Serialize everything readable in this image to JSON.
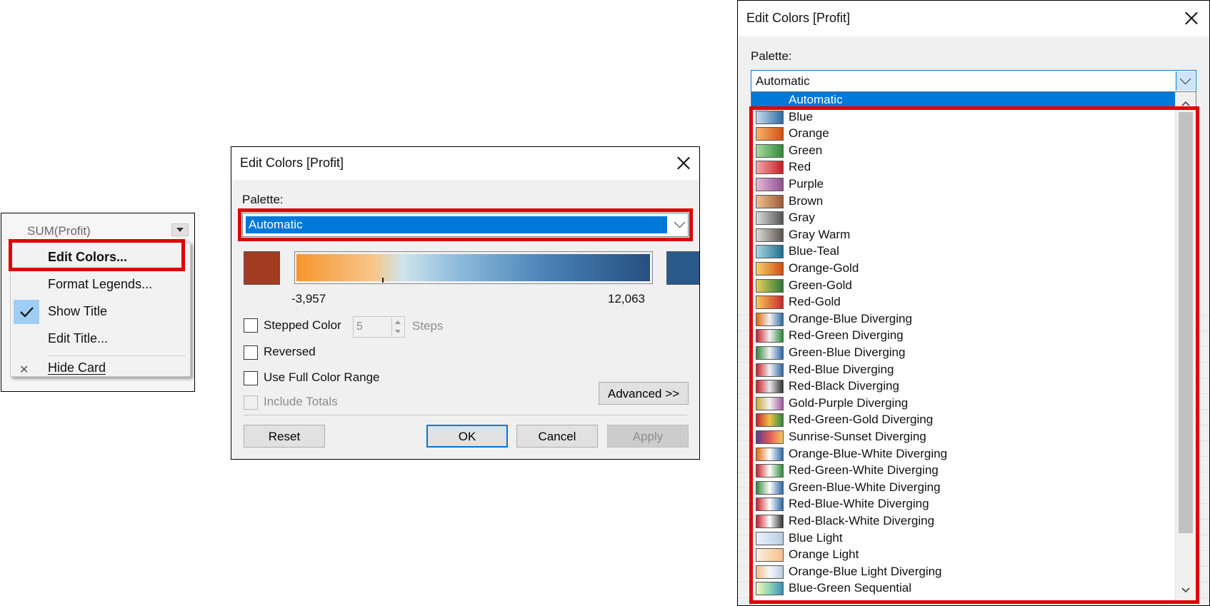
{
  "colors": {
    "selection_blue": "#0078d7",
    "highlight_red": "#e00000",
    "start_swatch": "#a23b22",
    "end_swatch": "#2a5a8c"
  },
  "menu": {
    "card_label": "SUM(Profit)",
    "items": [
      {
        "label": "Edit Colors...",
        "icon": ""
      },
      {
        "label": "Format Legends...",
        "icon": ""
      },
      {
        "label": "Show Title",
        "icon": "checkmark-icon"
      },
      {
        "label": "Edit Title...",
        "icon": ""
      },
      {
        "label": "Hide Card",
        "icon": "close-icon"
      }
    ]
  },
  "dialog": {
    "title": "Edit Colors [Profit]",
    "palette_label": "Palette:",
    "palette_value": "Automatic",
    "range_min": "-3,957",
    "range_max": "12,063",
    "stepped_color_label": "Stepped Color",
    "steps_value": "5",
    "steps_label": "Steps",
    "reversed_label": "Reversed",
    "full_range_label": "Use Full Color Range",
    "include_totals_label": "Include Totals",
    "advanced_label": "Advanced >>",
    "reset_label": "Reset",
    "ok_label": "OK",
    "cancel_label": "Cancel",
    "apply_label": "Apply"
  },
  "dropdown": {
    "title": "Edit Colors [Profit]",
    "palette_label": "Palette:",
    "palette_value": "Automatic",
    "selected_label": "Automatic",
    "items": [
      {
        "label": "Blue",
        "gradient": "linear-gradient(90deg,#c8dcee,#2f6aa3)"
      },
      {
        "label": "Orange",
        "gradient": "linear-gradient(90deg,#f9b26a,#d2500e)"
      },
      {
        "label": "Green",
        "gradient": "linear-gradient(90deg,#a8dc9c,#2f8a3a)"
      },
      {
        "label": "Red",
        "gradient": "linear-gradient(90deg,#f6a7a7,#c81e24)"
      },
      {
        "label": "Purple",
        "gradient": "linear-gradient(90deg,#e5b9d8,#8e5192)"
      },
      {
        "label": "Brown",
        "gradient": "linear-gradient(90deg,#f1c28f,#9a5a37)"
      },
      {
        "label": "Gray",
        "gradient": "linear-gradient(90deg,#dcdcdc,#555555)"
      },
      {
        "label": "Gray Warm",
        "gradient": "linear-gradient(90deg,#dedad5,#5b5550)"
      },
      {
        "label": "Blue-Teal",
        "gradient": "linear-gradient(90deg,#a8d8e3,#1e6d8f)"
      },
      {
        "label": "Orange-Gold",
        "gradient": "linear-gradient(90deg,#f6d06a,#d24c12)"
      },
      {
        "label": "Green-Gold",
        "gradient": "linear-gradient(90deg,#e8d15a,#2c7a3a)"
      },
      {
        "label": "Red-Gold",
        "gradient": "linear-gradient(90deg,#f6c85a,#cc2a2a)"
      },
      {
        "label": "Orange-Blue Diverging",
        "gradient": "linear-gradient(90deg,#e0690f,#f2f2f2,#2d6aa5)"
      },
      {
        "label": "Red-Green Diverging",
        "gradient": "linear-gradient(90deg,#c8222a,#f2f2f2,#2f8a3a)"
      },
      {
        "label": "Green-Blue Diverging",
        "gradient": "linear-gradient(90deg,#2f8a3a,#f2f2f2,#2d6aa5)"
      },
      {
        "label": "Red-Blue Diverging",
        "gradient": "linear-gradient(90deg,#c8222a,#f2f2f2,#2d6aa5)"
      },
      {
        "label": "Red-Black Diverging",
        "gradient": "linear-gradient(90deg,#c8222a,#e8e8e8,#333333)"
      },
      {
        "label": "Gold-Purple Diverging",
        "gradient": "linear-gradient(90deg,#c9a93a,#f2f2f2,#a05c9c)"
      },
      {
        "label": "Red-Green-Gold Diverging",
        "gradient": "linear-gradient(90deg,#c8222a,#f0c04a,#2f8a3a)"
      },
      {
        "label": "Sunrise-Sunset Diverging",
        "gradient": "linear-gradient(90deg,#5a3b8c,#e05a5a,#f6c85a)"
      },
      {
        "label": "Orange-Blue-White Diverging",
        "gradient": "linear-gradient(90deg,#e0690f,#ffffff,#2d6aa5)"
      },
      {
        "label": "Red-Green-White Diverging",
        "gradient": "linear-gradient(90deg,#c8222a,#ffffff,#2f8a3a)"
      },
      {
        "label": "Green-Blue-White Diverging",
        "gradient": "linear-gradient(90deg,#2f8a3a,#ffffff,#2d6aa5)"
      },
      {
        "label": "Red-Blue-White Diverging",
        "gradient": "linear-gradient(90deg,#c8222a,#ffffff,#2d6aa5)"
      },
      {
        "label": "Red-Black-White Diverging",
        "gradient": "linear-gradient(90deg,#c8222a,#ffffff,#333333)"
      },
      {
        "label": "Blue Light",
        "gradient": "linear-gradient(90deg,#eaf1f9,#b9cde6)"
      },
      {
        "label": "Orange Light",
        "gradient": "linear-gradient(90deg,#fdeedf,#f5bf8c)"
      },
      {
        "label": "Orange-Blue Light Diverging",
        "gradient": "linear-gradient(90deg,#f5bf8c,#f7f7f7,#b9cde6)"
      },
      {
        "label": "Blue-Green Sequential",
        "gradient": "linear-gradient(90deg,#f4f7b8,#8fd3b5,#3a8fb7)"
      }
    ]
  }
}
